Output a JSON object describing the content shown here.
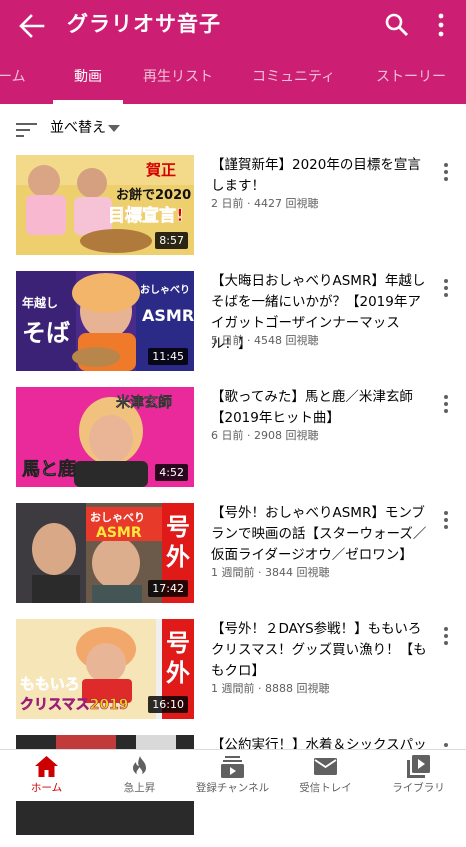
{
  "header": {
    "title": "グラリオサ音子",
    "back_icon": "arrow-back-icon",
    "search_icon": "search-icon",
    "more_icon": "more-vert-icon",
    "background": "#cc1f73"
  },
  "tabs": [
    {
      "label": "ホーム"
    },
    {
      "label": "動画",
      "active": true
    },
    {
      "label": "再生リスト"
    },
    {
      "label": "コミュニティ"
    },
    {
      "label": "ストーリー"
    }
  ],
  "sort": {
    "label": "並べ替え",
    "icon": "sort-icon"
  },
  "videos": [
    {
      "title": "【謹賀新年】2020年の目標を宣言します！",
      "meta": "2 日前 · 4427 回視聴",
      "duration": "8:57",
      "thumb_text": [
        "賀正",
        "お餅で2020",
        "目標宣言!"
      ]
    },
    {
      "title": "【大晦日おしゃべりASMR】年越しそばを一緒にいかが？【2019年アイガットゴーザインナーマッスル！】",
      "meta": "5 日前 · 4548 回視聴",
      "duration": "11:45",
      "thumb_text": [
        "年越し",
        "そば",
        "おしゃべり",
        "ASMR"
      ]
    },
    {
      "title": "【歌ってみた】馬と鹿／米津玄師【2019年ヒット曲】",
      "meta": "6 日前 · 2908 回視聴",
      "duration": "4:52",
      "thumb_text": [
        "米津玄師",
        "馬と鹿"
      ]
    },
    {
      "title": "【号外！おしゃべりASMR】モンブランで映画の話【スターウォーズ／仮面ライダージオウ／ゼロワン】",
      "meta": "1 週間前 · 3844 回視聴",
      "duration": "17:42",
      "thumb_text": [
        "おしゃべり",
        "ASMR",
        "号",
        "外"
      ]
    },
    {
      "title": "【号外！２DAYS参戦！】ももいろクリスマス！グッズ買い漁り！【ももクロ】",
      "meta": "1 週間前 · 8888 回視聴",
      "duration": "16:10",
      "thumb_text": [
        "号",
        "外",
        "ももいろ",
        "クリスマス2019"
      ]
    },
    {
      "title": "【公約実行！】水着＆シックスパッ",
      "meta": "",
      "duration": ""
    }
  ],
  "bottom_nav": [
    {
      "label": "ホーム",
      "icon": "home-icon",
      "active": true
    },
    {
      "label": "急上昇",
      "icon": "trending-fire-icon"
    },
    {
      "label": "登録チャンネル",
      "icon": "subscriptions-icon"
    },
    {
      "label": "受信トレイ",
      "icon": "inbox-mail-icon"
    },
    {
      "label": "ライブラリ",
      "icon": "library-icon"
    }
  ],
  "colors": {
    "accent": "#cc1f73",
    "nav_active": "#cc0000",
    "meta_text": "#606060"
  }
}
